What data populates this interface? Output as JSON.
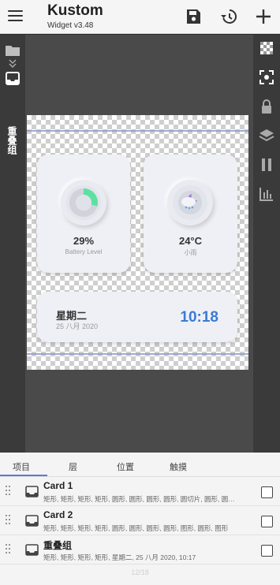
{
  "app": {
    "title": "Kustom",
    "subtitle": "Widget v3.48"
  },
  "toolbar": {
    "save_icon": "save-icon",
    "history_icon": "history-icon",
    "add_icon": "add-icon"
  },
  "sidebar_left": {
    "layer_label": "重叠组"
  },
  "widget": {
    "battery": {
      "value": "29%",
      "label": "Battery Level",
      "level_percent": 29
    },
    "weather": {
      "value": "24°C",
      "label": "小雨"
    },
    "clock": {
      "day": "星期二",
      "date": "25 八月 2020",
      "time": "10:18"
    }
  },
  "tabs": [
    "项目",
    "层",
    "位置",
    "触摸"
  ],
  "items": [
    {
      "name": "Card 1",
      "desc": "矩形, 矩形, 矩形, 矩形, 圆形, 圆形, 圆形, 圆形, 圆切片, 圆形, 圆…"
    },
    {
      "name": "Card 2",
      "desc": "矩形, 矩形, 矩形, 矩形, 圆形, 圆形, 圆形, 圆形, 图形, 圆形, 图形"
    },
    {
      "name": "重叠组",
      "desc": "矩形, 矩形, 矩形, 矩形, 星期二, 25 八月 2020, 10:17"
    }
  ],
  "pager": "12/18",
  "colors": {
    "accent": "#3a7bd5",
    "battery_green": "#5ee0a0",
    "tab_underline": "#5b7bd5"
  }
}
